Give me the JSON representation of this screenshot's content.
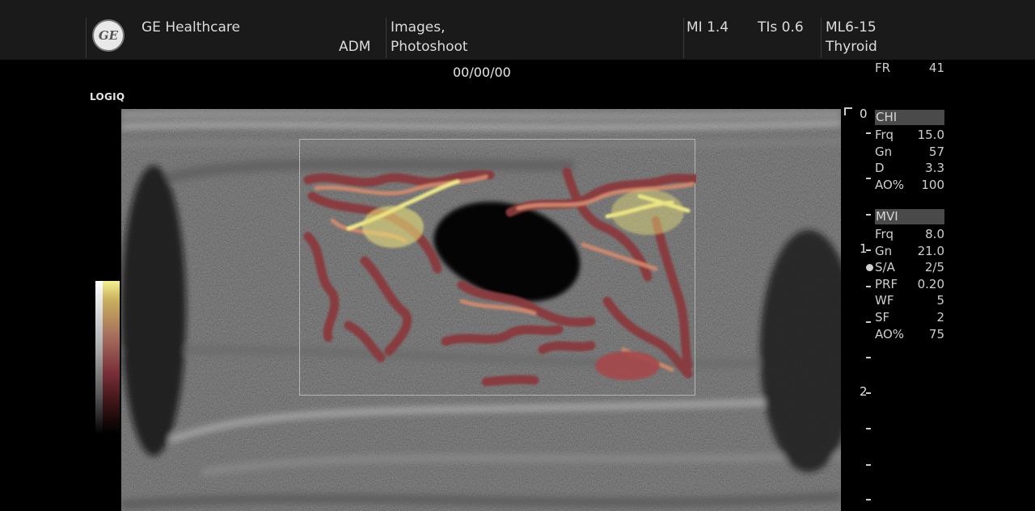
{
  "header": {
    "brand_name": "GE Healthcare",
    "logo_mark": "GE",
    "operator": "ADM",
    "category_line1": "Images,",
    "category_line2": "Photoshoot",
    "mi": "MI 1.4",
    "tis": "TIs 0.6",
    "probe": "ML6-15",
    "preset": "Thyroid"
  },
  "date": "00/00/00",
  "device_brand": "LOGIQ",
  "frame_rate": {
    "label": "FR",
    "value": "41"
  },
  "chi": {
    "title": "CHI",
    "rows": [
      {
        "label": "Frq",
        "value": "15.0"
      },
      {
        "label": "Gn",
        "value": "57"
      },
      {
        "label": "D",
        "value": "3.3"
      },
      {
        "label": "AO%",
        "value": "100"
      }
    ]
  },
  "mvi": {
    "title": "MVI",
    "rows": [
      {
        "label": "Frq",
        "value": "8.0"
      },
      {
        "label": "Gn",
        "value": "21.0"
      },
      {
        "label": "S/A",
        "value": "2/5"
      },
      {
        "label": "PRF",
        "value": "0.20"
      },
      {
        "label": "WF",
        "value": "5"
      },
      {
        "label": "SF",
        "value": "2"
      },
      {
        "label": "AO%",
        "value": "75"
      }
    ]
  },
  "depth_scale": {
    "labels": [
      "0",
      "1",
      "2"
    ]
  },
  "colors": {
    "flow_high": "#f5f08a",
    "flow_mid": "#d98a6c",
    "flow_low": "#8c3a3e",
    "background": "#000000",
    "header_bg": "#1a1a1a"
  },
  "icons": [
    "ge-logo-icon",
    "focus-marker-icon"
  ]
}
